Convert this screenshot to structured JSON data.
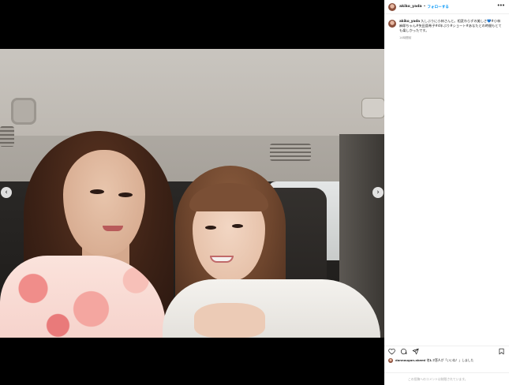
{
  "post": {
    "username": "akiko_yada",
    "separator": "•",
    "follow_label": "フォローする",
    "more_label": "•••",
    "caption_username": "akiko_yada",
    "caption_text": "久しぶりに小林さんと。相変わらずの美しさ💙#小林麻耶ちゃん#矢田亜希子#4年ぶり#ショート#あなたとの時間もとても楽しかったです。",
    "caption_time": "14時間前",
    "liked_by_user": "dannougan.akemi",
    "likes_text_prefix": "他",
    "likes_count": "1.7万人",
    "likes_text_suffix": "が「いいね！」しました",
    "comment_note": "この投稿へのコメントは制限されています。"
  },
  "icons": {
    "like": "heart-icon",
    "comment": "comment-icon",
    "share": "share-icon",
    "save": "bookmark-icon",
    "prev": "chevron-left-icon",
    "next": "chevron-right-icon"
  },
  "nav": {
    "prev_glyph": "‹",
    "next_glyph": "›"
  },
  "colors": {
    "accent": "#0095f6",
    "text": "#262626",
    "muted": "#8e8e8e"
  }
}
